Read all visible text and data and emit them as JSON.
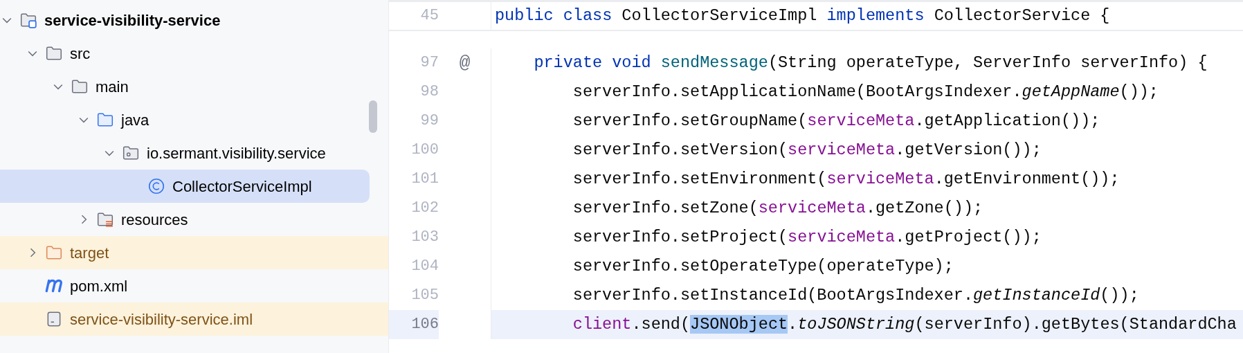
{
  "project_tree": [
    {
      "label": "service-visibility-service",
      "kind": "module",
      "expanded": true,
      "selected": false,
      "excluded": false,
      "children": [
        {
          "label": "src",
          "kind": "folder",
          "expanded": true,
          "selected": false,
          "excluded": false,
          "children": [
            {
              "label": "main",
              "kind": "folder",
              "expanded": true,
              "selected": false,
              "excluded": false,
              "children": [
                {
                  "label": "java",
                  "kind": "source-folder",
                  "expanded": true,
                  "selected": false,
                  "excluded": false,
                  "children": [
                    {
                      "label": "io.sermant.visibility.service",
                      "kind": "package",
                      "expanded": true,
                      "selected": false,
                      "excluded": false,
                      "children": [
                        {
                          "label": "CollectorServiceImpl",
                          "kind": "class",
                          "selected": true,
                          "excluded": false
                        }
                      ]
                    }
                  ]
                },
                {
                  "label": "resources",
                  "kind": "resources-folder",
                  "expanded": false,
                  "selected": false,
                  "excluded": false
                }
              ]
            }
          ]
        },
        {
          "label": "target",
          "kind": "folder",
          "expanded": false,
          "selected": false,
          "excluded": true
        },
        {
          "label": "pom.xml",
          "kind": "maven",
          "selected": false,
          "excluded": false
        },
        {
          "label": "service-visibility-service.iml",
          "kind": "module-file",
          "selected": false,
          "excluded": true
        }
      ]
    }
  ],
  "editor": {
    "sticky_line": {
      "number": "45",
      "current": false,
      "segments": [
        {
          "kind": "keyword",
          "text": "public class"
        },
        {
          "kind": "plain",
          "text": " CollectorServiceImpl "
        },
        {
          "kind": "keyword",
          "text": "implements"
        },
        {
          "kind": "plain",
          "text": " CollectorService {"
        }
      ]
    },
    "lines": [
      {
        "number": "97",
        "marker": "@",
        "current": false,
        "segments": [
          {
            "kind": "keyword",
            "text": "private void "
          },
          {
            "kind": "declaration",
            "text": "sendMessage"
          },
          {
            "kind": "plain",
            "text": "(String operateType, ServerInfo serverInfo) {"
          }
        ],
        "children": [
          {
            "number": "98",
            "current": false,
            "segments": [
              {
                "kind": "plain",
                "text": "serverInfo.setApplicationName(BootArgsIndexer."
              },
              {
                "kind": "static",
                "text": "getAppName"
              },
              {
                "kind": "plain",
                "text": "());"
              }
            ]
          },
          {
            "number": "99",
            "current": false,
            "segments": [
              {
                "kind": "plain",
                "text": "serverInfo.setGroupName("
              },
              {
                "kind": "field",
                "text": "serviceMeta"
              },
              {
                "kind": "plain",
                "text": ".getApplication());"
              }
            ]
          },
          {
            "number": "100",
            "current": false,
            "segments": [
              {
                "kind": "plain",
                "text": "serverInfo.setVersion("
              },
              {
                "kind": "field",
                "text": "serviceMeta"
              },
              {
                "kind": "plain",
                "text": ".getVersion());"
              }
            ]
          },
          {
            "number": "101",
            "current": false,
            "segments": [
              {
                "kind": "plain",
                "text": "serverInfo.setEnvironment("
              },
              {
                "kind": "field",
                "text": "serviceMeta"
              },
              {
                "kind": "plain",
                "text": ".getEnvironment());"
              }
            ]
          },
          {
            "number": "102",
            "current": false,
            "segments": [
              {
                "kind": "plain",
                "text": "serverInfo.setZone("
              },
              {
                "kind": "field",
                "text": "serviceMeta"
              },
              {
                "kind": "plain",
                "text": ".getZone());"
              }
            ]
          },
          {
            "number": "103",
            "current": false,
            "segments": [
              {
                "kind": "plain",
                "text": "serverInfo.setProject("
              },
              {
                "kind": "field",
                "text": "serviceMeta"
              },
              {
                "kind": "plain",
                "text": ".getProject());"
              }
            ]
          },
          {
            "number": "104",
            "current": false,
            "segments": [
              {
                "kind": "plain",
                "text": "serverInfo.setOperateType(operateType);"
              }
            ]
          },
          {
            "number": "105",
            "current": false,
            "segments": [
              {
                "kind": "plain",
                "text": "serverInfo.setInstanceId(BootArgsIndexer."
              },
              {
                "kind": "static",
                "text": "getInstanceId"
              },
              {
                "kind": "plain",
                "text": "());"
              }
            ]
          },
          {
            "number": "106",
            "current": true,
            "segments": [
              {
                "kind": "field",
                "text": "client"
              },
              {
                "kind": "plain",
                "text": ".send("
              },
              {
                "kind": "selection",
                "text": "JSONObject"
              },
              {
                "kind": "plain",
                "text": "."
              },
              {
                "kind": "static",
                "text": "toJSONString"
              },
              {
                "kind": "plain",
                "text": "(serverInfo).getBytes(StandardCha"
              }
            ]
          }
        ]
      }
    ]
  }
}
